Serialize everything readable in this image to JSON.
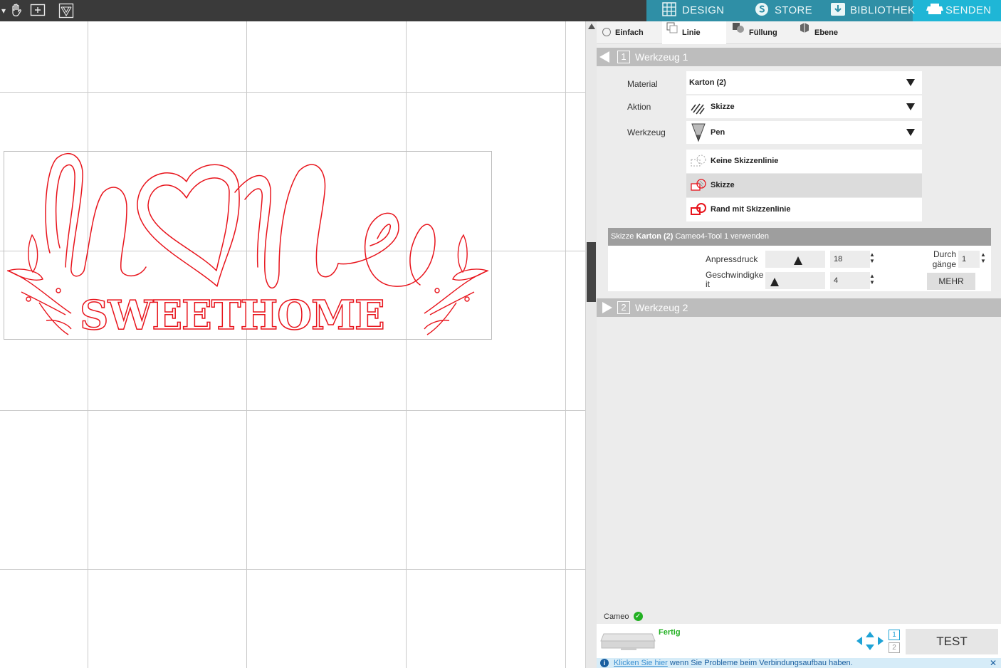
{
  "nav": {
    "design": "DESIGN",
    "store": "STORE",
    "bibliothek": "BIBLIOTHEK",
    "senden": "SENDEN"
  },
  "modes": {
    "einfach": "Einfach",
    "linie": "Linie",
    "fuellung": "Füllung",
    "ebene": "Ebene"
  },
  "werkzeug1": {
    "num": "1",
    "label": "Werkzeug 1"
  },
  "werkzeug2": {
    "num": "2",
    "label": "Werkzeug 2"
  },
  "fields": {
    "material_label": "Material",
    "material_value": "Karton (2)",
    "aktion_label": "Aktion",
    "aktion_value": "Skizze",
    "werkzeug_label": "Werkzeug",
    "werkzeug_value": "Pen"
  },
  "sketch_options": [
    "Keine Skizzenlinie",
    "Skizze",
    "Rand mit Skizzenlinie"
  ],
  "sub": {
    "prefix": "Skizze ",
    "material": "Karton (2)",
    "suffix": " Cameo4-Tool 1 verwenden"
  },
  "settings": {
    "anpressdruck_label": "Anpressdruck",
    "anpressdruck_value": "18",
    "geschwindigkeit_label": "Geschwindigke it",
    "geschwindigkeit_value": "4",
    "durchgaenge_label": "Durch gänge",
    "durchgaenge_value": "1",
    "mehr": "MEHR"
  },
  "device": {
    "name": "Cameo",
    "status": "Fertig",
    "test": "TEST",
    "page1": "1",
    "page2": "2"
  },
  "info": {
    "link": "Klicken Sie hier",
    "text": " wenn Sie Probleme beim Verbindungsaufbau haben."
  },
  "design_text": "SWEETHOME",
  "colors": {
    "accent": "#1fb6d6",
    "nav": "#2f8fa6",
    "design": "#e8141c",
    "ok": "#22b022"
  }
}
